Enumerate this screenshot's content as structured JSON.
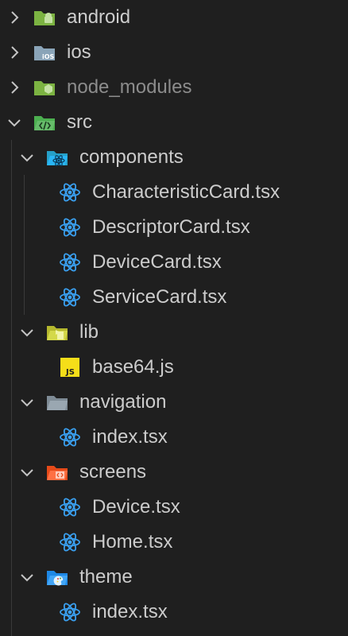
{
  "explorer": {
    "items": [
      {
        "label": "android",
        "kind": "folder",
        "state": "collapsed"
      },
      {
        "label": "ios",
        "kind": "folder",
        "state": "collapsed"
      },
      {
        "label": "node_modules",
        "kind": "folder",
        "state": "collapsed"
      },
      {
        "label": "src",
        "kind": "folder",
        "state": "expanded"
      },
      {
        "label": "components",
        "kind": "folder",
        "state": "expanded"
      },
      {
        "label": "CharacteristicCard.tsx",
        "kind": "file"
      },
      {
        "label": "DescriptorCard.tsx",
        "kind": "file"
      },
      {
        "label": "DeviceCard.tsx",
        "kind": "file"
      },
      {
        "label": "ServiceCard.tsx",
        "kind": "file"
      },
      {
        "label": "lib",
        "kind": "folder",
        "state": "expanded"
      },
      {
        "label": "base64.js",
        "kind": "file"
      },
      {
        "label": "navigation",
        "kind": "folder",
        "state": "expanded"
      },
      {
        "label": "index.tsx",
        "kind": "file"
      },
      {
        "label": "screens",
        "kind": "folder",
        "state": "expanded"
      },
      {
        "label": "Device.tsx",
        "kind": "file"
      },
      {
        "label": "Home.tsx",
        "kind": "file"
      },
      {
        "label": "theme",
        "kind": "folder",
        "state": "expanded"
      },
      {
        "label": "index.tsx",
        "kind": "file"
      }
    ]
  },
  "icons": {
    "android_folder": "android-folder-icon",
    "ios_folder": "ios-folder-icon",
    "node_folder": "node-folder-icon",
    "src_folder": "src-folder-icon",
    "components_folder": "react-components-folder-icon",
    "lib_folder": "lib-folder-icon",
    "navigation_folder": "navigation-folder-icon",
    "screens_folder": "screens-folder-icon",
    "theme_folder": "theme-folder-icon",
    "tsx_file": "react-tsx-file-icon",
    "js_file": "javascript-file-icon"
  },
  "colors": {
    "background": "#1f1f1f",
    "text": "#cccccc",
    "ignored_text": "#8c8c8c",
    "react_blue": "#3aa0f0",
    "js_yellow": "#f5de19",
    "android_green": "#8bc34a",
    "screens_orange": "#ff7043"
  }
}
